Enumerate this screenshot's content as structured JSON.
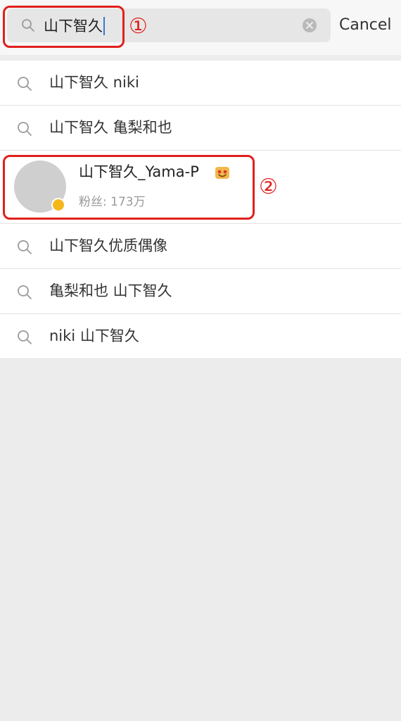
{
  "search": {
    "query": "山下智久",
    "icon": "search-icon",
    "clear_icon": "clear-icon"
  },
  "cancel_label": "Cancel",
  "results": [
    {
      "type": "suggestion",
      "label": "山下智久 niki",
      "icon": "search-icon"
    },
    {
      "type": "suggestion",
      "label": "山下智久 亀梨和也",
      "icon": "search-icon"
    },
    {
      "type": "user",
      "name": "山下智久_Yama-P",
      "fans": "粉丝: 173万",
      "badge": "verified-badge",
      "emoji": "smiley-emoji"
    },
    {
      "type": "suggestion",
      "label": "山下智久优质偶像",
      "icon": "search-icon"
    },
    {
      "type": "suggestion",
      "label": "亀梨和也 山下智久",
      "icon": "search-icon"
    },
    {
      "type": "suggestion",
      "label": "niki 山下智久",
      "icon": "search-icon"
    }
  ],
  "annotations": {
    "marker_1": "①",
    "marker_2": "②",
    "color": "#e0201c"
  }
}
